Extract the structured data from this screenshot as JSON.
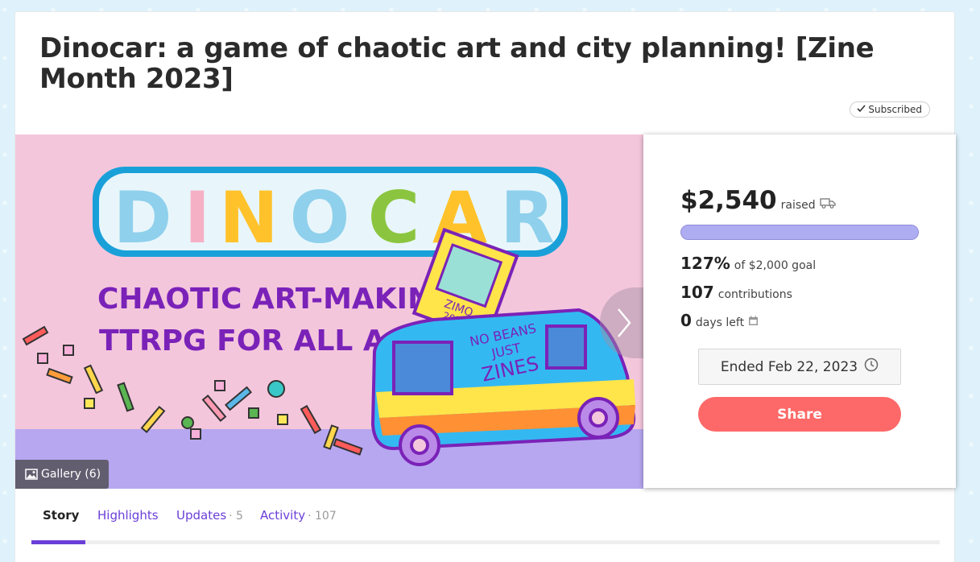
{
  "campaign": {
    "title": "Dinocar: a game of chaotic art and city planning! [Zine Month 2023]",
    "subscribed_label": "Subscribed"
  },
  "hero": {
    "logo_text": "DINOCAR",
    "tagline_line1": "CHAOTIC ART-MAKING",
    "tagline_line2": "TTRPG FOR ALL AGES",
    "van_text": [
      "NO BEANS",
      "JUST",
      "ZINES"
    ],
    "book_text": [
      "ZIMO",
      "2023"
    ],
    "gallery_label": "Gallery (6)"
  },
  "stats": {
    "raised_amount": "$2,540",
    "raised_label": "raised",
    "progress_fraction": 1.0,
    "percent": "127%",
    "goal_label": "of $2,000 goal",
    "contributions": "107",
    "contributions_label": "contributions",
    "days_left": "0",
    "days_left_label": "days left",
    "ended_label": "Ended Feb 22, 2023",
    "share_label": "Share"
  },
  "tabs": [
    {
      "label": "Story",
      "count": ""
    },
    {
      "label": "Highlights",
      "count": ""
    },
    {
      "label": "Updates",
      "count": "5"
    },
    {
      "label": "Activity",
      "count": "107"
    }
  ],
  "colors": {
    "accent": "#6a3fd8",
    "share": "#fd6968",
    "progress": "#b5b4f5"
  }
}
